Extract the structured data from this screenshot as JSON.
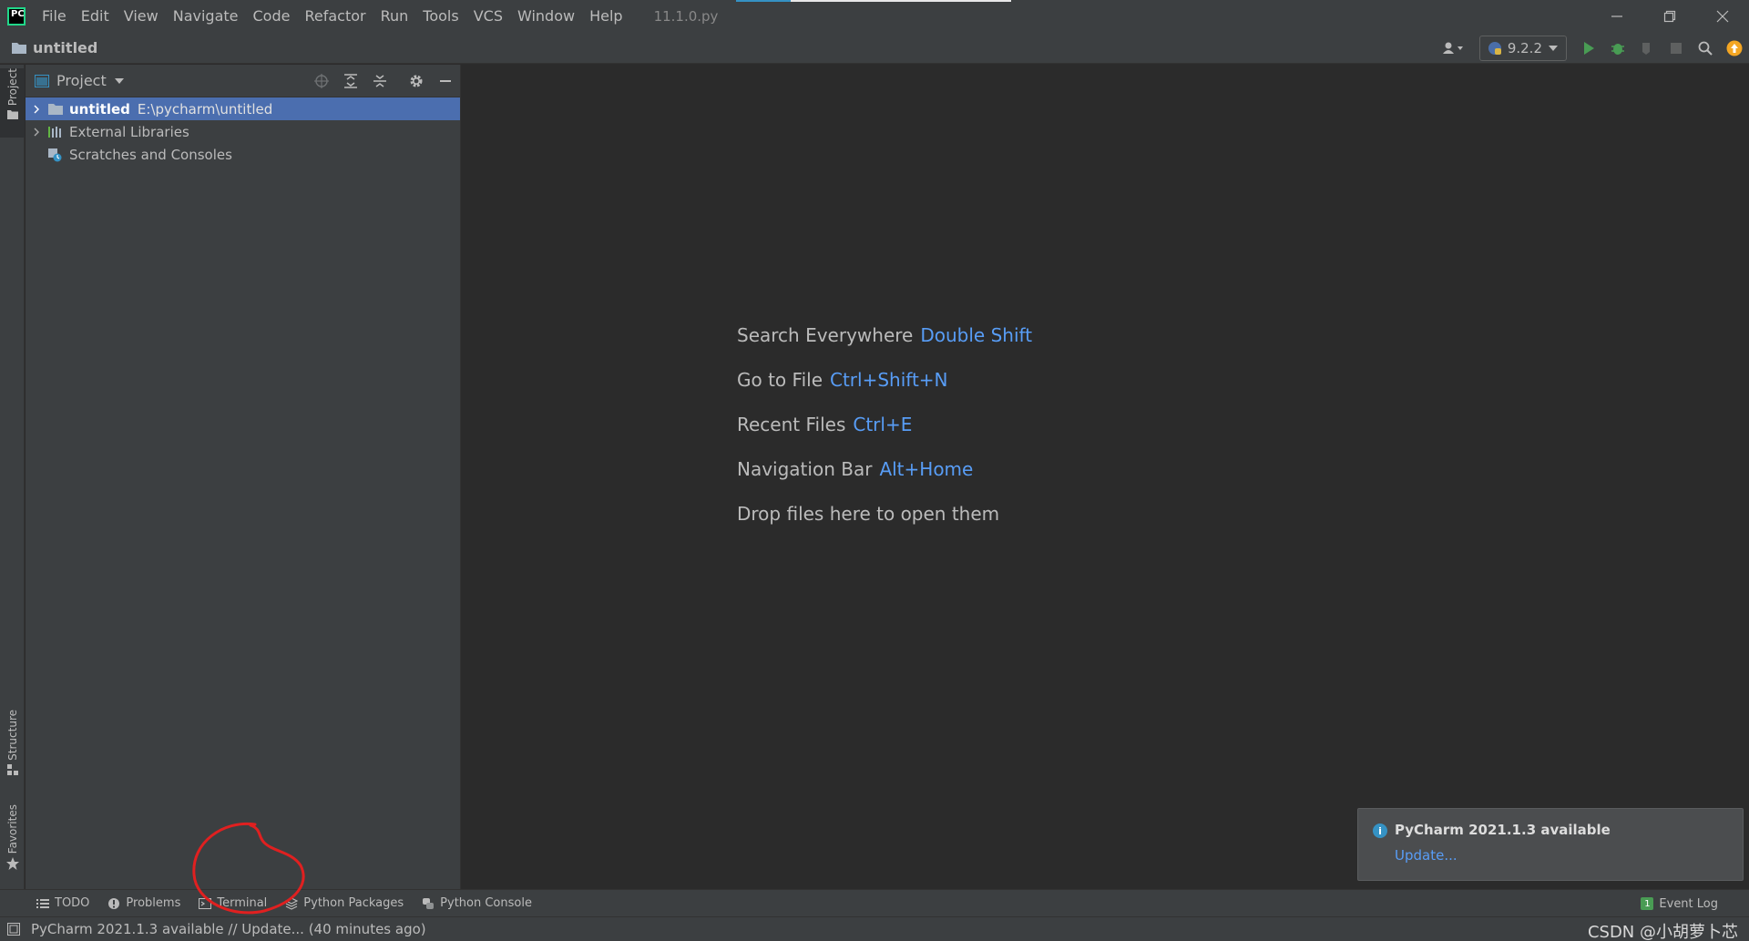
{
  "titlebar": {
    "menus": [
      {
        "label": "File"
      },
      {
        "label": "Edit"
      },
      {
        "label": "View"
      },
      {
        "label": "Navigate"
      },
      {
        "label": "Code"
      },
      {
        "label": "Refactor"
      },
      {
        "label": "Run"
      },
      {
        "label": "Tools"
      },
      {
        "label": "VCS"
      },
      {
        "label": "Window"
      },
      {
        "label": "Help"
      }
    ],
    "file_title": "11.1.0.py"
  },
  "navbar": {
    "project_name": "untitled",
    "interpreter_label": "9.2.2"
  },
  "left_stripe": {
    "project": "Project",
    "structure": "Structure",
    "favorites": "Favorites"
  },
  "project_panel": {
    "title": "Project",
    "tree": [
      {
        "label": "untitled",
        "path": "E:\\pycharm\\untitled"
      },
      {
        "label": "External Libraries"
      },
      {
        "label": "Scratches and Consoles"
      }
    ]
  },
  "editor": {
    "hints": [
      {
        "text": "Search Everywhere",
        "shortcut": "Double Shift"
      },
      {
        "text": "Go to File",
        "shortcut": "Ctrl+Shift+N"
      },
      {
        "text": "Recent Files",
        "shortcut": "Ctrl+E"
      },
      {
        "text": "Navigation Bar",
        "shortcut": "Alt+Home"
      },
      {
        "text": "Drop files here to open them",
        "shortcut": ""
      }
    ]
  },
  "notification": {
    "title": "PyCharm 2021.1.3 available",
    "link": "Update..."
  },
  "bottom_bar": {
    "tabs": [
      {
        "label": "TODO",
        "icon": "list-icon"
      },
      {
        "label": "Problems",
        "icon": "problems-icon"
      },
      {
        "label": "Terminal",
        "icon": "terminal-icon"
      },
      {
        "label": "Python Packages",
        "icon": "packages-icon"
      },
      {
        "label": "Python Console",
        "icon": "python-console-icon"
      }
    ],
    "event_log_label": "Event Log",
    "event_log_count": "1"
  },
  "status_bar": {
    "message": "PyCharm 2021.1.3 available // Update... (40 minutes ago)",
    "watermark": "CSDN @小胡萝卜芯"
  },
  "colors": {
    "accent_blue": "#589df6",
    "selection": "#4b6eaf",
    "run_green": "#499c54",
    "annotation_red": "#e02020"
  }
}
